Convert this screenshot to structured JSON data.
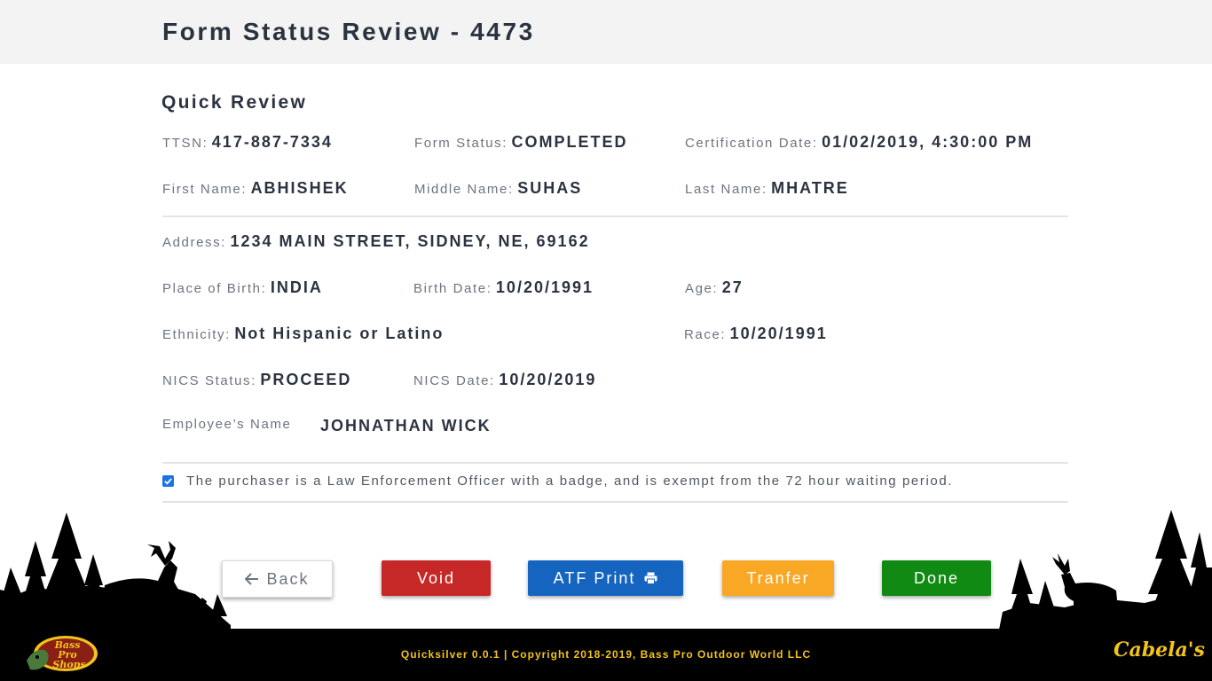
{
  "header": {
    "title": "Form Status Review - 4473"
  },
  "quick_review": {
    "title": "Quick Review",
    "ttsn": {
      "label": "TTSN:",
      "value": "417-887-7334"
    },
    "form_status": {
      "label": "Form Status:",
      "value": "COMPLETED"
    },
    "certification_date": {
      "label": "Certification Date:",
      "value": "01/02/2019, 4:30:00 PM"
    },
    "first_name": {
      "label": "First Name:",
      "value": "ABHISHEK"
    },
    "middle_name": {
      "label": "Middle Name:",
      "value": "SUHAS"
    },
    "last_name": {
      "label": "Last Name:",
      "value": "MHATRE"
    },
    "address": {
      "label": "Address:",
      "value": "1234 MAIN STREET, SIDNEY, NE, 69162"
    },
    "place_of_birth": {
      "label": "Place of Birth:",
      "value": "INDIA"
    },
    "birth_date": {
      "label": "Birth Date:",
      "value": "10/20/1991"
    },
    "age": {
      "label": "Age:",
      "value": "27"
    },
    "ethnicity": {
      "label": "Ethnicity:",
      "value": "Not Hispanic or Latino"
    },
    "race": {
      "label": "Race:",
      "value": "10/20/1991"
    },
    "nics_status": {
      "label": "NICS Status:",
      "value": "PROCEED"
    },
    "nics_date": {
      "label": "NICS Date:",
      "value": "10/20/2019"
    },
    "employee_name": {
      "label": "Employee’s Name",
      "value": "JOHNATHAN WICK"
    }
  },
  "law_enforcement": {
    "checked": true,
    "text": "The purchaser is a Law Enforcement Officer with a badge, and is exempt from the 72 hour waiting period."
  },
  "actions": {
    "back": "Back",
    "void": "Void",
    "atf_print": "ATF Print",
    "transfer": "Tranfer",
    "done": "Done"
  },
  "icons": {
    "back": "arrow-left-icon",
    "print": "printer-icon",
    "checkbox": "check-icon"
  },
  "colors": {
    "void": "#c62828",
    "atf_print": "#1565c0",
    "transfer": "#f9a825",
    "done": "#108a12",
    "footer_text": "#f2c31b"
  },
  "footer": {
    "text": "Quicksilver 0.0.1 | Copyright 2018-2019, Bass Pro Outdoor World LLC",
    "logo_left": "Bass Pro Shops",
    "logo_right": "Cabela's"
  }
}
